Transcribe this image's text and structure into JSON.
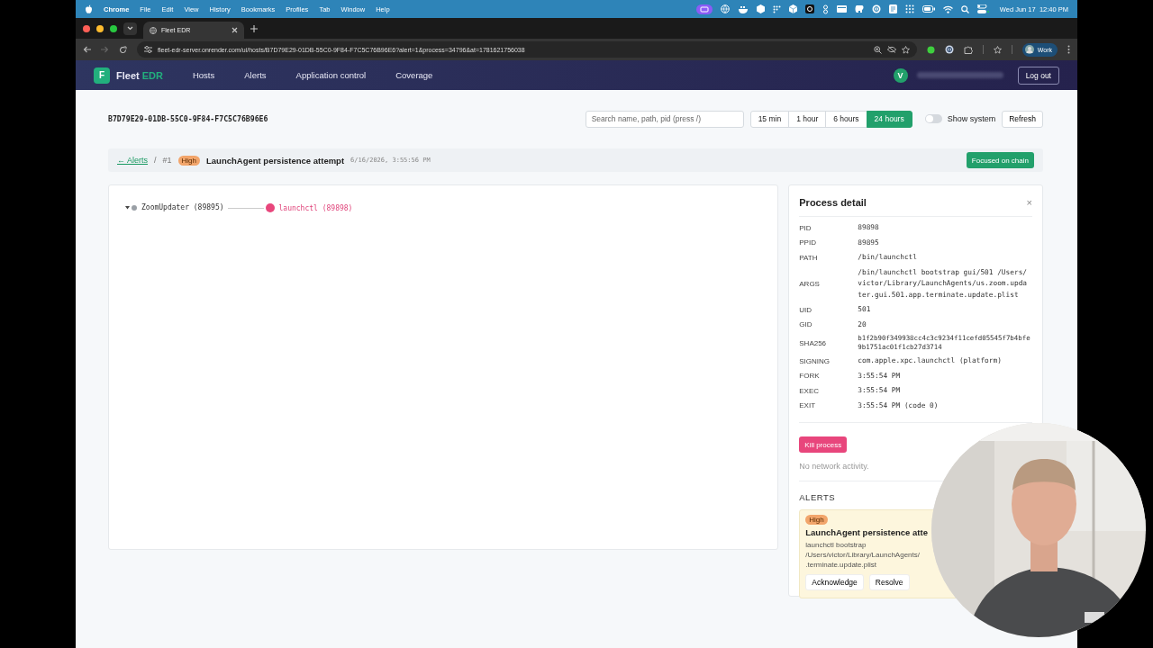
{
  "menubar": {
    "app": "Chrome",
    "menus": [
      "File",
      "Edit",
      "View",
      "History",
      "Bookmarks",
      "Profiles",
      "Tab",
      "Window",
      "Help"
    ],
    "clock": "Wed Jun 17  12:40 PM"
  },
  "browser": {
    "tab_title": "Fleet EDR",
    "url": "fleet-edr-server.onrender.com/ui/hosts/B7D79E29-01DB-55C0-9F84-F7C5C76B96E6?alert=1&process=34796&at=1781621756038",
    "profile": "Work"
  },
  "app": {
    "logo_letter": "F",
    "brand": "Fleet",
    "brand_accent": "EDR",
    "nav": [
      {
        "label": "Hosts"
      },
      {
        "label": "Alerts"
      },
      {
        "label": "Application control"
      },
      {
        "label": "Coverage"
      }
    ],
    "avatar": "V",
    "logout": "Log out"
  },
  "host": {
    "id": "B7D79E29-01DB-55C0-9F84-F7C5C76B96E6",
    "search_placeholder": "Search name, path, pid (press /)",
    "ranges": [
      {
        "label": "15 min",
        "selected": false
      },
      {
        "label": "1 hour",
        "selected": false
      },
      {
        "label": "6 hours",
        "selected": false
      },
      {
        "label": "24 hours",
        "selected": true
      }
    ],
    "show_system": {
      "label": "Show system",
      "on": false
    },
    "refresh": "Refresh"
  },
  "alert_bar": {
    "back": "← Alerts",
    "separator": "/",
    "number": "#1",
    "severity": "High",
    "title": "LaunchAgent persistence attempt",
    "time": "6/16/2026, 3:55:56 PM",
    "focus": "Focused on chain"
  },
  "tree": [
    {
      "label": "ZoomUpdater (89895)",
      "expanded": true,
      "selected": false,
      "children": [
        {
          "label": "launchctl (89898)",
          "selected": true
        }
      ]
    }
  ],
  "detail": {
    "title": "Process detail",
    "close": "×",
    "fields": [
      {
        "label": "PID",
        "value": "89898"
      },
      {
        "label": "PPID",
        "value": "89895"
      },
      {
        "label": "PATH",
        "value": "/bin/launchctl"
      },
      {
        "label": "ARGS",
        "value": "/bin/launchctl bootstrap gui/501 /Users/victor/Library/LaunchAgents/us.zoom.updater.gui.501.app.terminate.update.plist"
      },
      {
        "label": "UID",
        "value": "501"
      },
      {
        "label": "GID",
        "value": "20"
      },
      {
        "label": "SHA256",
        "value": "b1f2b90f349938cc4c3c9234f11cefd05545f7b4bfe9b1751ac01f1cb27d3714",
        "kind": "hash"
      },
      {
        "label": "SIGNING",
        "value": "com.apple.xpc.launchctl (platform)"
      },
      {
        "label": "FORK",
        "value": "3:55:54 PM"
      },
      {
        "label": "EXEC",
        "value": "3:55:54 PM"
      },
      {
        "label": "EXIT",
        "value": "3:55:54 PM (code 0)"
      }
    ],
    "kill": "Kill process",
    "network": "No network activity.",
    "alerts_heading": "ALERTS",
    "alerts": [
      {
        "severity": "High",
        "title": "LaunchAgent persistence atte",
        "lines": [
          "launchctl bootstrap",
          "/Users/victor/Library/LaunchAgents/",
          ".terminate.update.plist"
        ],
        "actions": [
          "Acknowledge",
          "Resolve"
        ]
      }
    ]
  }
}
